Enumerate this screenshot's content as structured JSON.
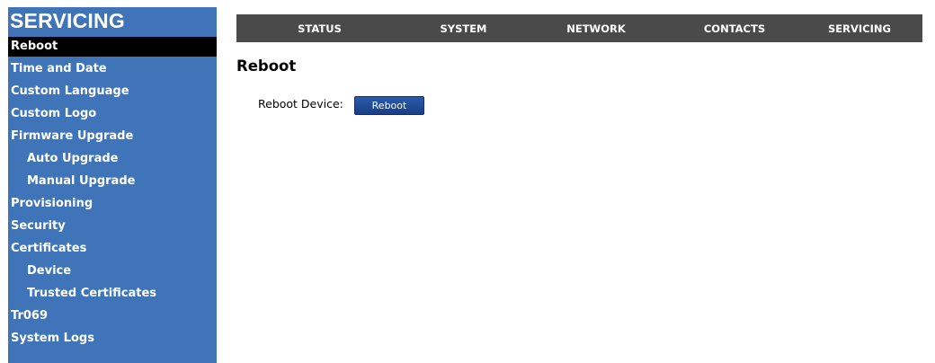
{
  "sidebar": {
    "title": "SERVICING",
    "items": [
      {
        "label": "Reboot",
        "active": true,
        "sub": false
      },
      {
        "label": "Time and Date",
        "active": false,
        "sub": false
      },
      {
        "label": "Custom Language",
        "active": false,
        "sub": false
      },
      {
        "label": "Custom Logo",
        "active": false,
        "sub": false
      },
      {
        "label": "Firmware Upgrade",
        "active": false,
        "sub": false
      },
      {
        "label": "Auto Upgrade",
        "active": false,
        "sub": true
      },
      {
        "label": "Manual Upgrade",
        "active": false,
        "sub": true
      },
      {
        "label": "Provisioning",
        "active": false,
        "sub": false
      },
      {
        "label": "Security",
        "active": false,
        "sub": false
      },
      {
        "label": "Certificates",
        "active": false,
        "sub": false
      },
      {
        "label": "Device",
        "active": false,
        "sub": true
      },
      {
        "label": "Trusted Certificates",
        "active": false,
        "sub": true
      },
      {
        "label": "Tr069",
        "active": false,
        "sub": false
      },
      {
        "label": "System Logs",
        "active": false,
        "sub": false
      }
    ]
  },
  "topnav": {
    "items": [
      "STATUS",
      "SYSTEM",
      "NETWORK",
      "CONTACTS",
      "SERVICING"
    ]
  },
  "main": {
    "title": "Reboot",
    "reboot_label": "Reboot Device:",
    "reboot_button": "Reboot"
  },
  "colors": {
    "sidebar_bg": "#3f74b8",
    "active_item_bg": "#000000",
    "topnav_bg": "#4a4a4a",
    "button_bg": "#1f4a96"
  }
}
